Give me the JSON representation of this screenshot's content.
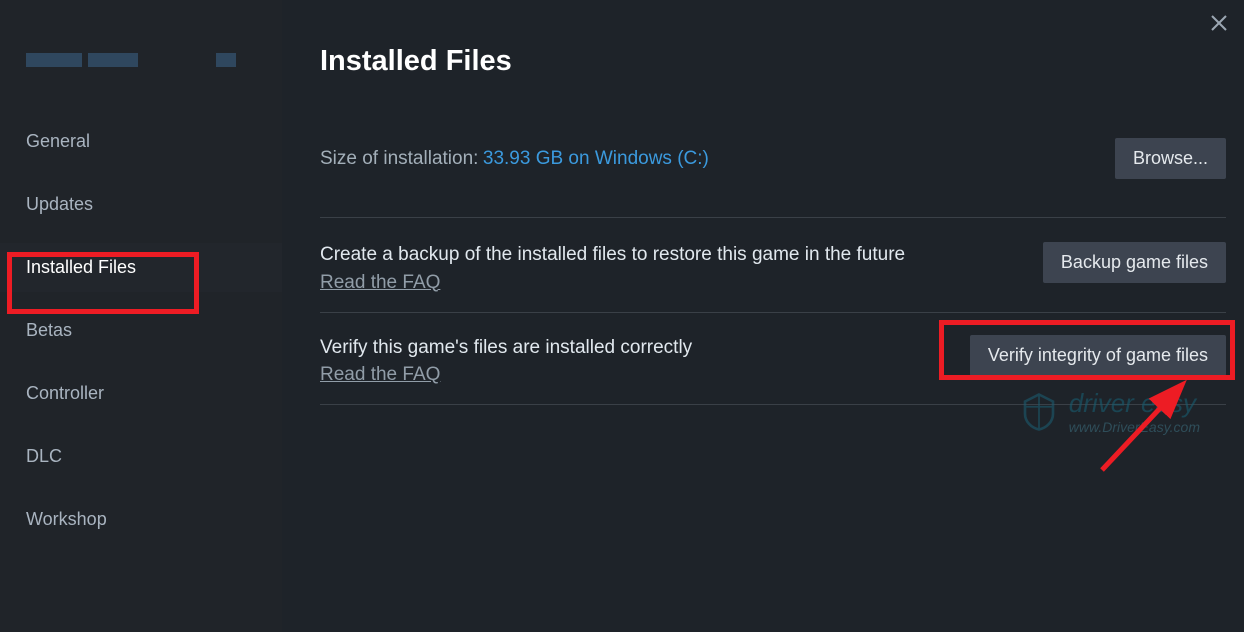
{
  "sidebar": {
    "items": [
      {
        "label": "General"
      },
      {
        "label": "Updates"
      },
      {
        "label": "Installed Files"
      },
      {
        "label": "Betas"
      },
      {
        "label": "Controller"
      },
      {
        "label": "DLC"
      },
      {
        "label": "Workshop"
      }
    ]
  },
  "header": {
    "title": "Installed Files"
  },
  "installation": {
    "size_label": "Size of installation:",
    "size_value": "33.93 GB on Windows (C:)",
    "browse_button": "Browse..."
  },
  "backup": {
    "description": "Create a backup of the installed files to restore this game in the future",
    "faq_link": "Read the FAQ",
    "button": "Backup game files"
  },
  "verify": {
    "description": "Verify this game's files are installed correctly",
    "faq_link": "Read the FAQ",
    "button": "Verify integrity of game files"
  },
  "watermark": {
    "brand": "driver easy",
    "url": "www.DriverEasy.com"
  }
}
